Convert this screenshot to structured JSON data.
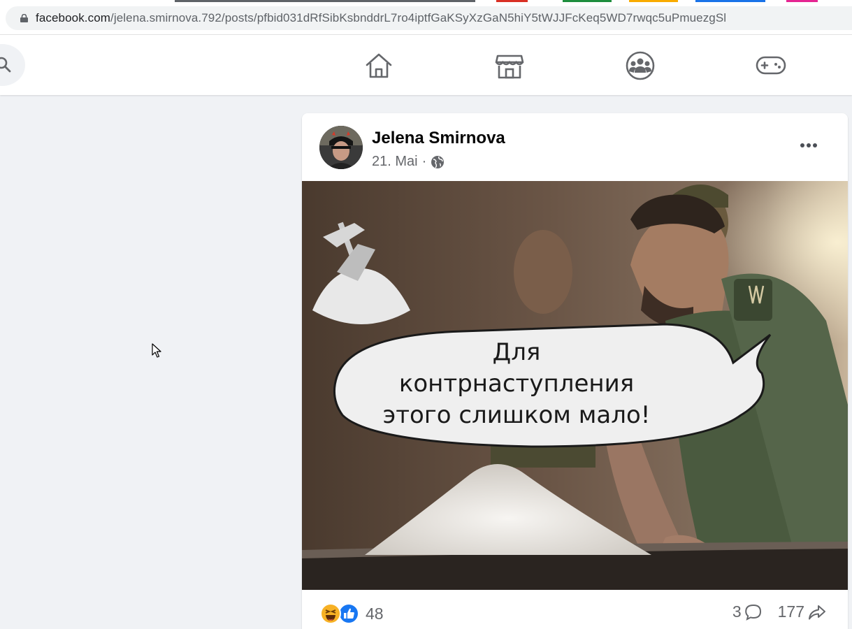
{
  "browser": {
    "url_domain": "facebook.com",
    "url_path": "/jelena.smirnova.792/posts/pfbid031dRfSibKsbnddrL7ro4iptfGaKSyXzGaN5hiY5tWJJFcKeq5WD7rwqc5uPmuezgSl"
  },
  "nav": {
    "items": [
      {
        "icon": "home-icon"
      },
      {
        "icon": "marketplace-icon"
      },
      {
        "icon": "groups-icon"
      },
      {
        "icon": "gaming-icon"
      }
    ]
  },
  "post": {
    "author": "Jelena Smirnova",
    "date": "21. Mai",
    "separator": "·",
    "audience_icon": "globe-icon",
    "image_caption_lines": [
      "Для",
      "контрнаступления",
      "этого слишком мало!"
    ],
    "reaction_count": "48",
    "comment_count": "3",
    "share_count": "177"
  },
  "colors": {
    "fb_blue": "#1877f2",
    "page_bg": "#f0f2f5",
    "secondary_text": "#65676b"
  }
}
